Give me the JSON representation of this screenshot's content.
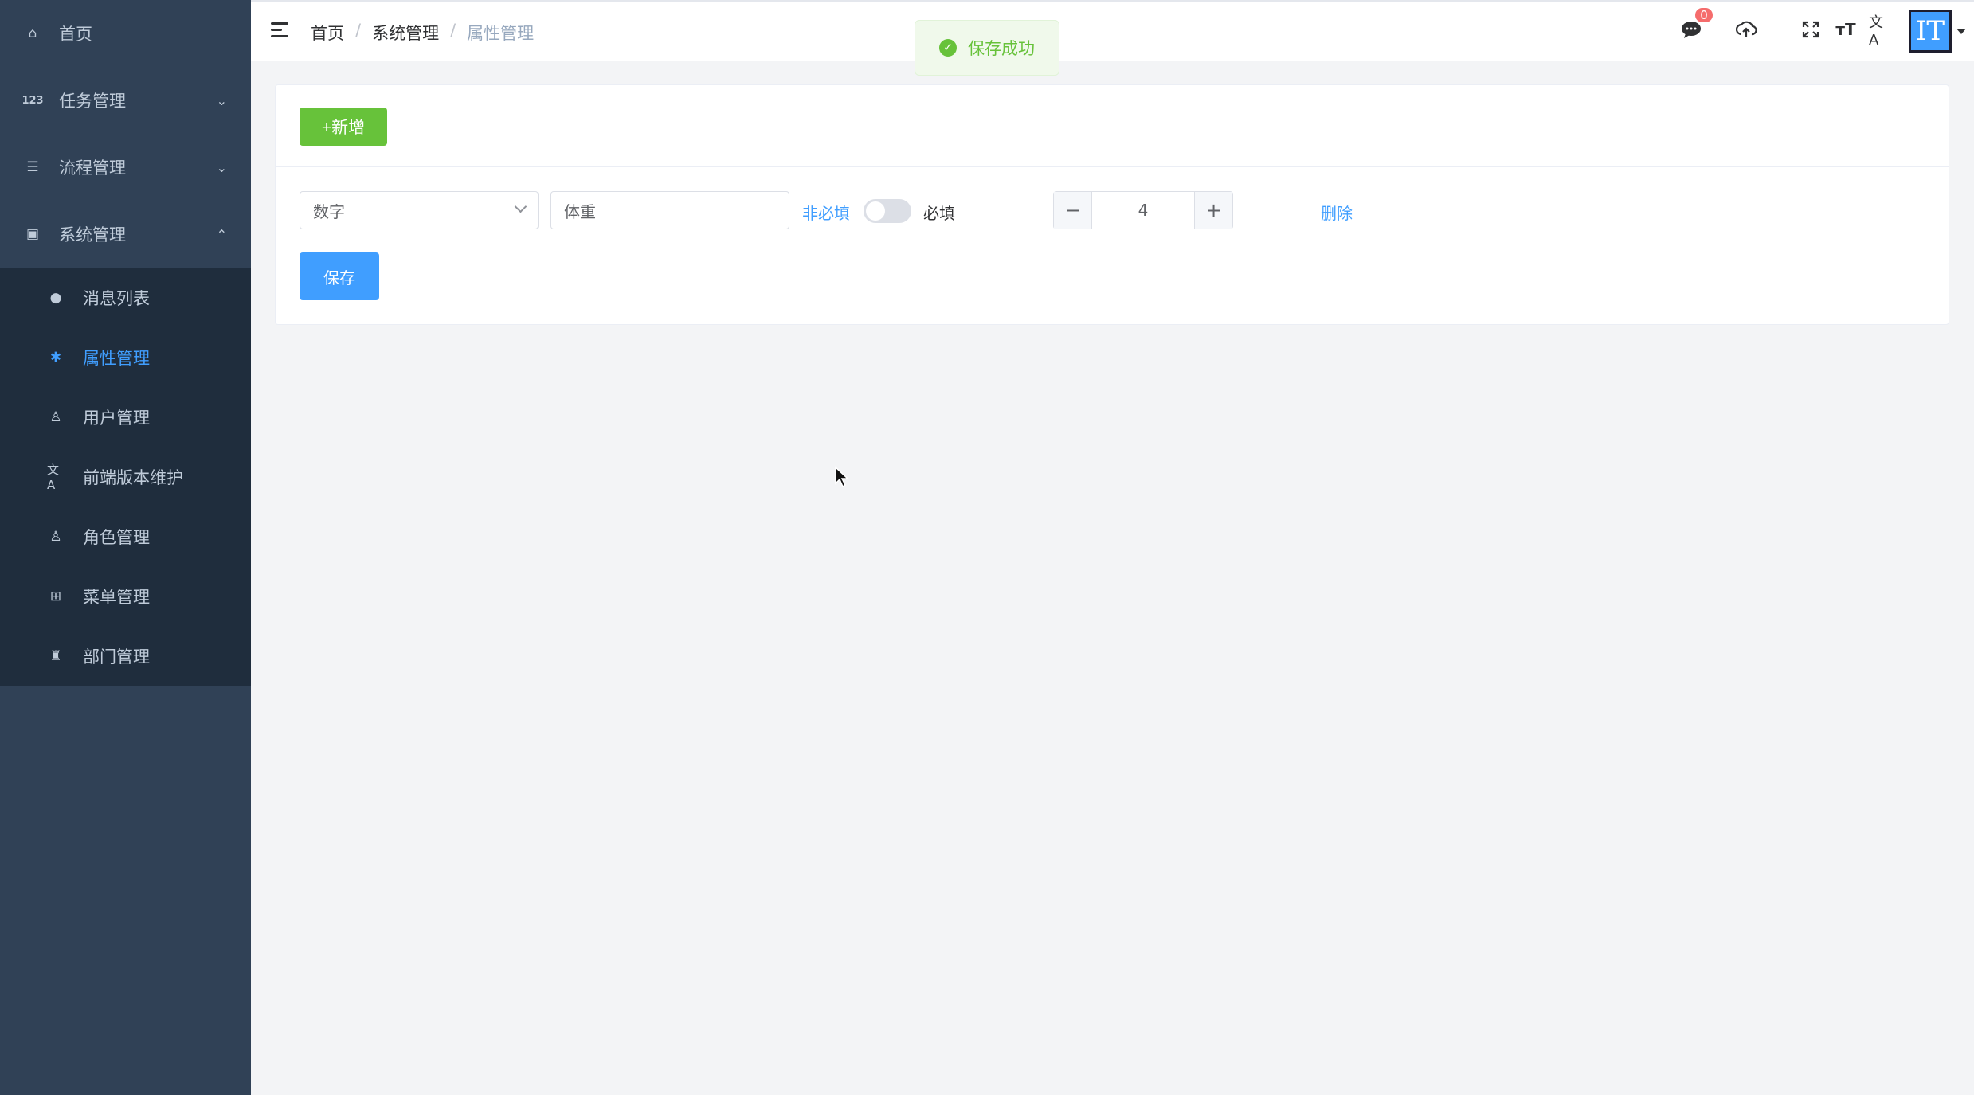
{
  "sidebar": {
    "items": [
      {
        "label": "首页",
        "icon": "home-icon"
      },
      {
        "label": "任务管理",
        "icon": "numbers-icon"
      },
      {
        "label": "流程管理",
        "icon": "tree-icon"
      },
      {
        "label": "系统管理",
        "icon": "system-icon"
      }
    ],
    "submenu": [
      {
        "label": "消息列表",
        "icon": "chat-icon"
      },
      {
        "label": "属性管理",
        "icon": "bug-icon",
        "active": true
      },
      {
        "label": "用户管理",
        "icon": "user-icon"
      },
      {
        "label": "前端版本维护",
        "icon": "translate-icon"
      },
      {
        "label": "角色管理",
        "icon": "role-icon"
      },
      {
        "label": "菜单管理",
        "icon": "grid-icon"
      },
      {
        "label": "部门管理",
        "icon": "org-icon"
      }
    ]
  },
  "navbar": {
    "breadcrumb": [
      "首页",
      "系统管理",
      "属性管理"
    ],
    "message_count": "0",
    "avatar_text": "IT"
  },
  "toast": {
    "text": "保存成功"
  },
  "form": {
    "add_button": "+新增",
    "type_select_value": "数字",
    "name_input_value": "体重",
    "optional_label": "非必填",
    "required_label": "必填",
    "required_switch_on": false,
    "stepper_value": "4",
    "delete_link": "删除",
    "save_button": "保存"
  },
  "colors": {
    "sidebar_bg": "#304156",
    "submenu_bg": "#1f2d3d",
    "active": "#409eff",
    "success": "#67c23a"
  }
}
